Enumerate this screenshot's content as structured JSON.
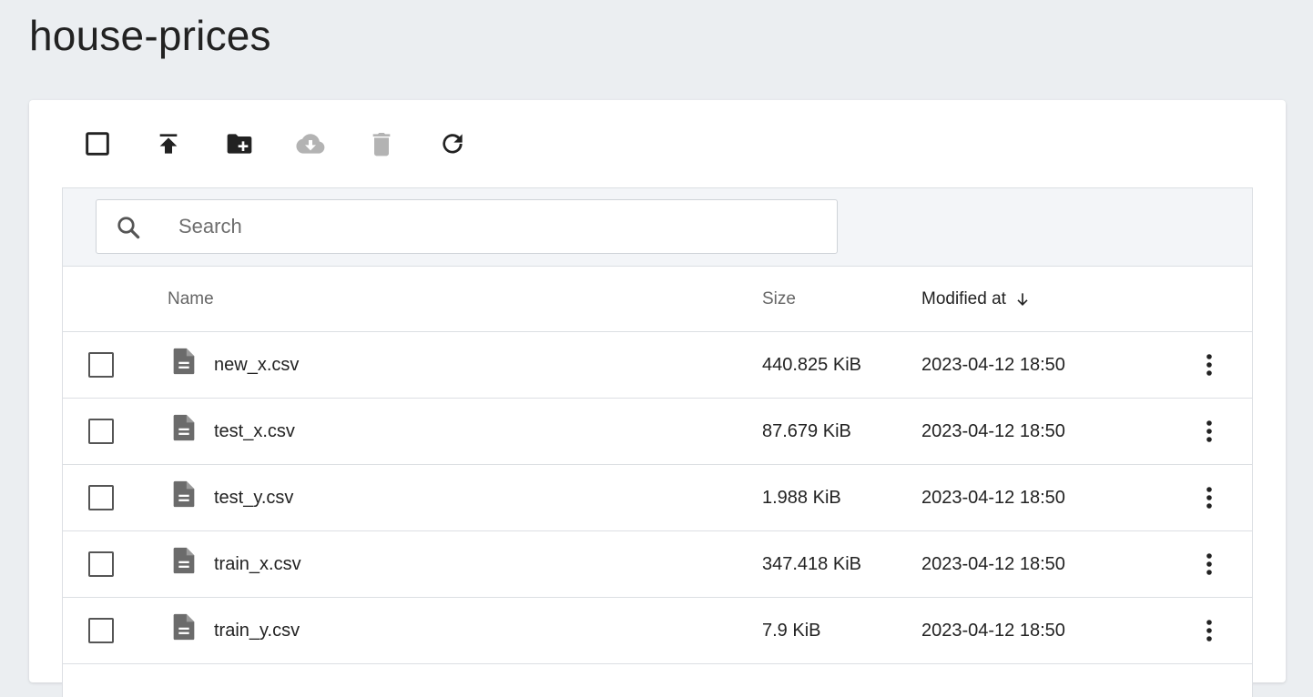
{
  "page": {
    "title": "house-prices"
  },
  "toolbar": {
    "buttons": [
      {
        "name": "select-all-checkbox",
        "icon": "checkbox-outline-icon",
        "enabled": true
      },
      {
        "name": "upload-button",
        "icon": "upload-icon",
        "enabled": true
      },
      {
        "name": "new-folder-button",
        "icon": "folder-plus-icon",
        "enabled": true
      },
      {
        "name": "download-button",
        "icon": "cloud-download-icon",
        "enabled": false
      },
      {
        "name": "delete-button",
        "icon": "trash-icon",
        "enabled": false
      },
      {
        "name": "refresh-button",
        "icon": "refresh-icon",
        "enabled": true
      }
    ]
  },
  "search": {
    "placeholder": "Search",
    "value": ""
  },
  "table": {
    "columns": {
      "name": "Name",
      "size": "Size",
      "modified": "Modified at"
    },
    "sort": {
      "column": "Modified at",
      "direction": "descending"
    },
    "rows": [
      {
        "name": "new_x.csv",
        "size": "440.825 KiB",
        "modified": "2023-04-12 18:50"
      },
      {
        "name": "test_x.csv",
        "size": "87.679 KiB",
        "modified": "2023-04-12 18:50"
      },
      {
        "name": "test_y.csv",
        "size": "1.988 KiB",
        "modified": "2023-04-12 18:50"
      },
      {
        "name": "train_x.csv",
        "size": "347.418 KiB",
        "modified": "2023-04-12 18:50"
      },
      {
        "name": "train_y.csv",
        "size": "7.9 KiB",
        "modified": "2023-04-12 18:50"
      }
    ]
  },
  "colors": {
    "background": "#ebeef1",
    "icon_active": "#222222",
    "icon_disabled": "#b3b3b3",
    "file_icon": "#6b6b6b"
  }
}
